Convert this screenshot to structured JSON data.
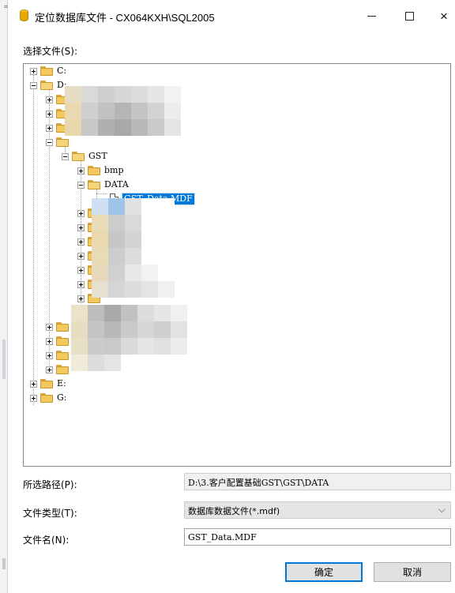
{
  "window": {
    "title": "定位数据库文件 - CX064KXH\\SQL2005",
    "minimize": "–",
    "maximize": "□",
    "close": "×"
  },
  "labels": {
    "select_file": "选择文件(S):",
    "selected_path": "所选路径(P):",
    "file_type": "文件类型(T):",
    "file_name": "文件名(N):"
  },
  "tree": {
    "drive_c": "C:",
    "drive_d": "D:",
    "folder_gst": "GST",
    "folder_bmp": "bmp",
    "folder_data": "DATA",
    "selected_file": "GST_Data.MDF",
    "drive_e": "E:",
    "drive_g": "G:"
  },
  "fields": {
    "selected_path_value": "D:\\3.客户配置基础GST\\GST\\DATA",
    "file_type_value": "数据库数据文件(*.mdf)",
    "file_name_value": "GST_Data.MDF"
  },
  "buttons": {
    "ok": "确定",
    "cancel": "取消"
  },
  "colors": {
    "selection": "#0078d7",
    "folder": "#f3c75b",
    "db_icon": "#e6a700"
  }
}
